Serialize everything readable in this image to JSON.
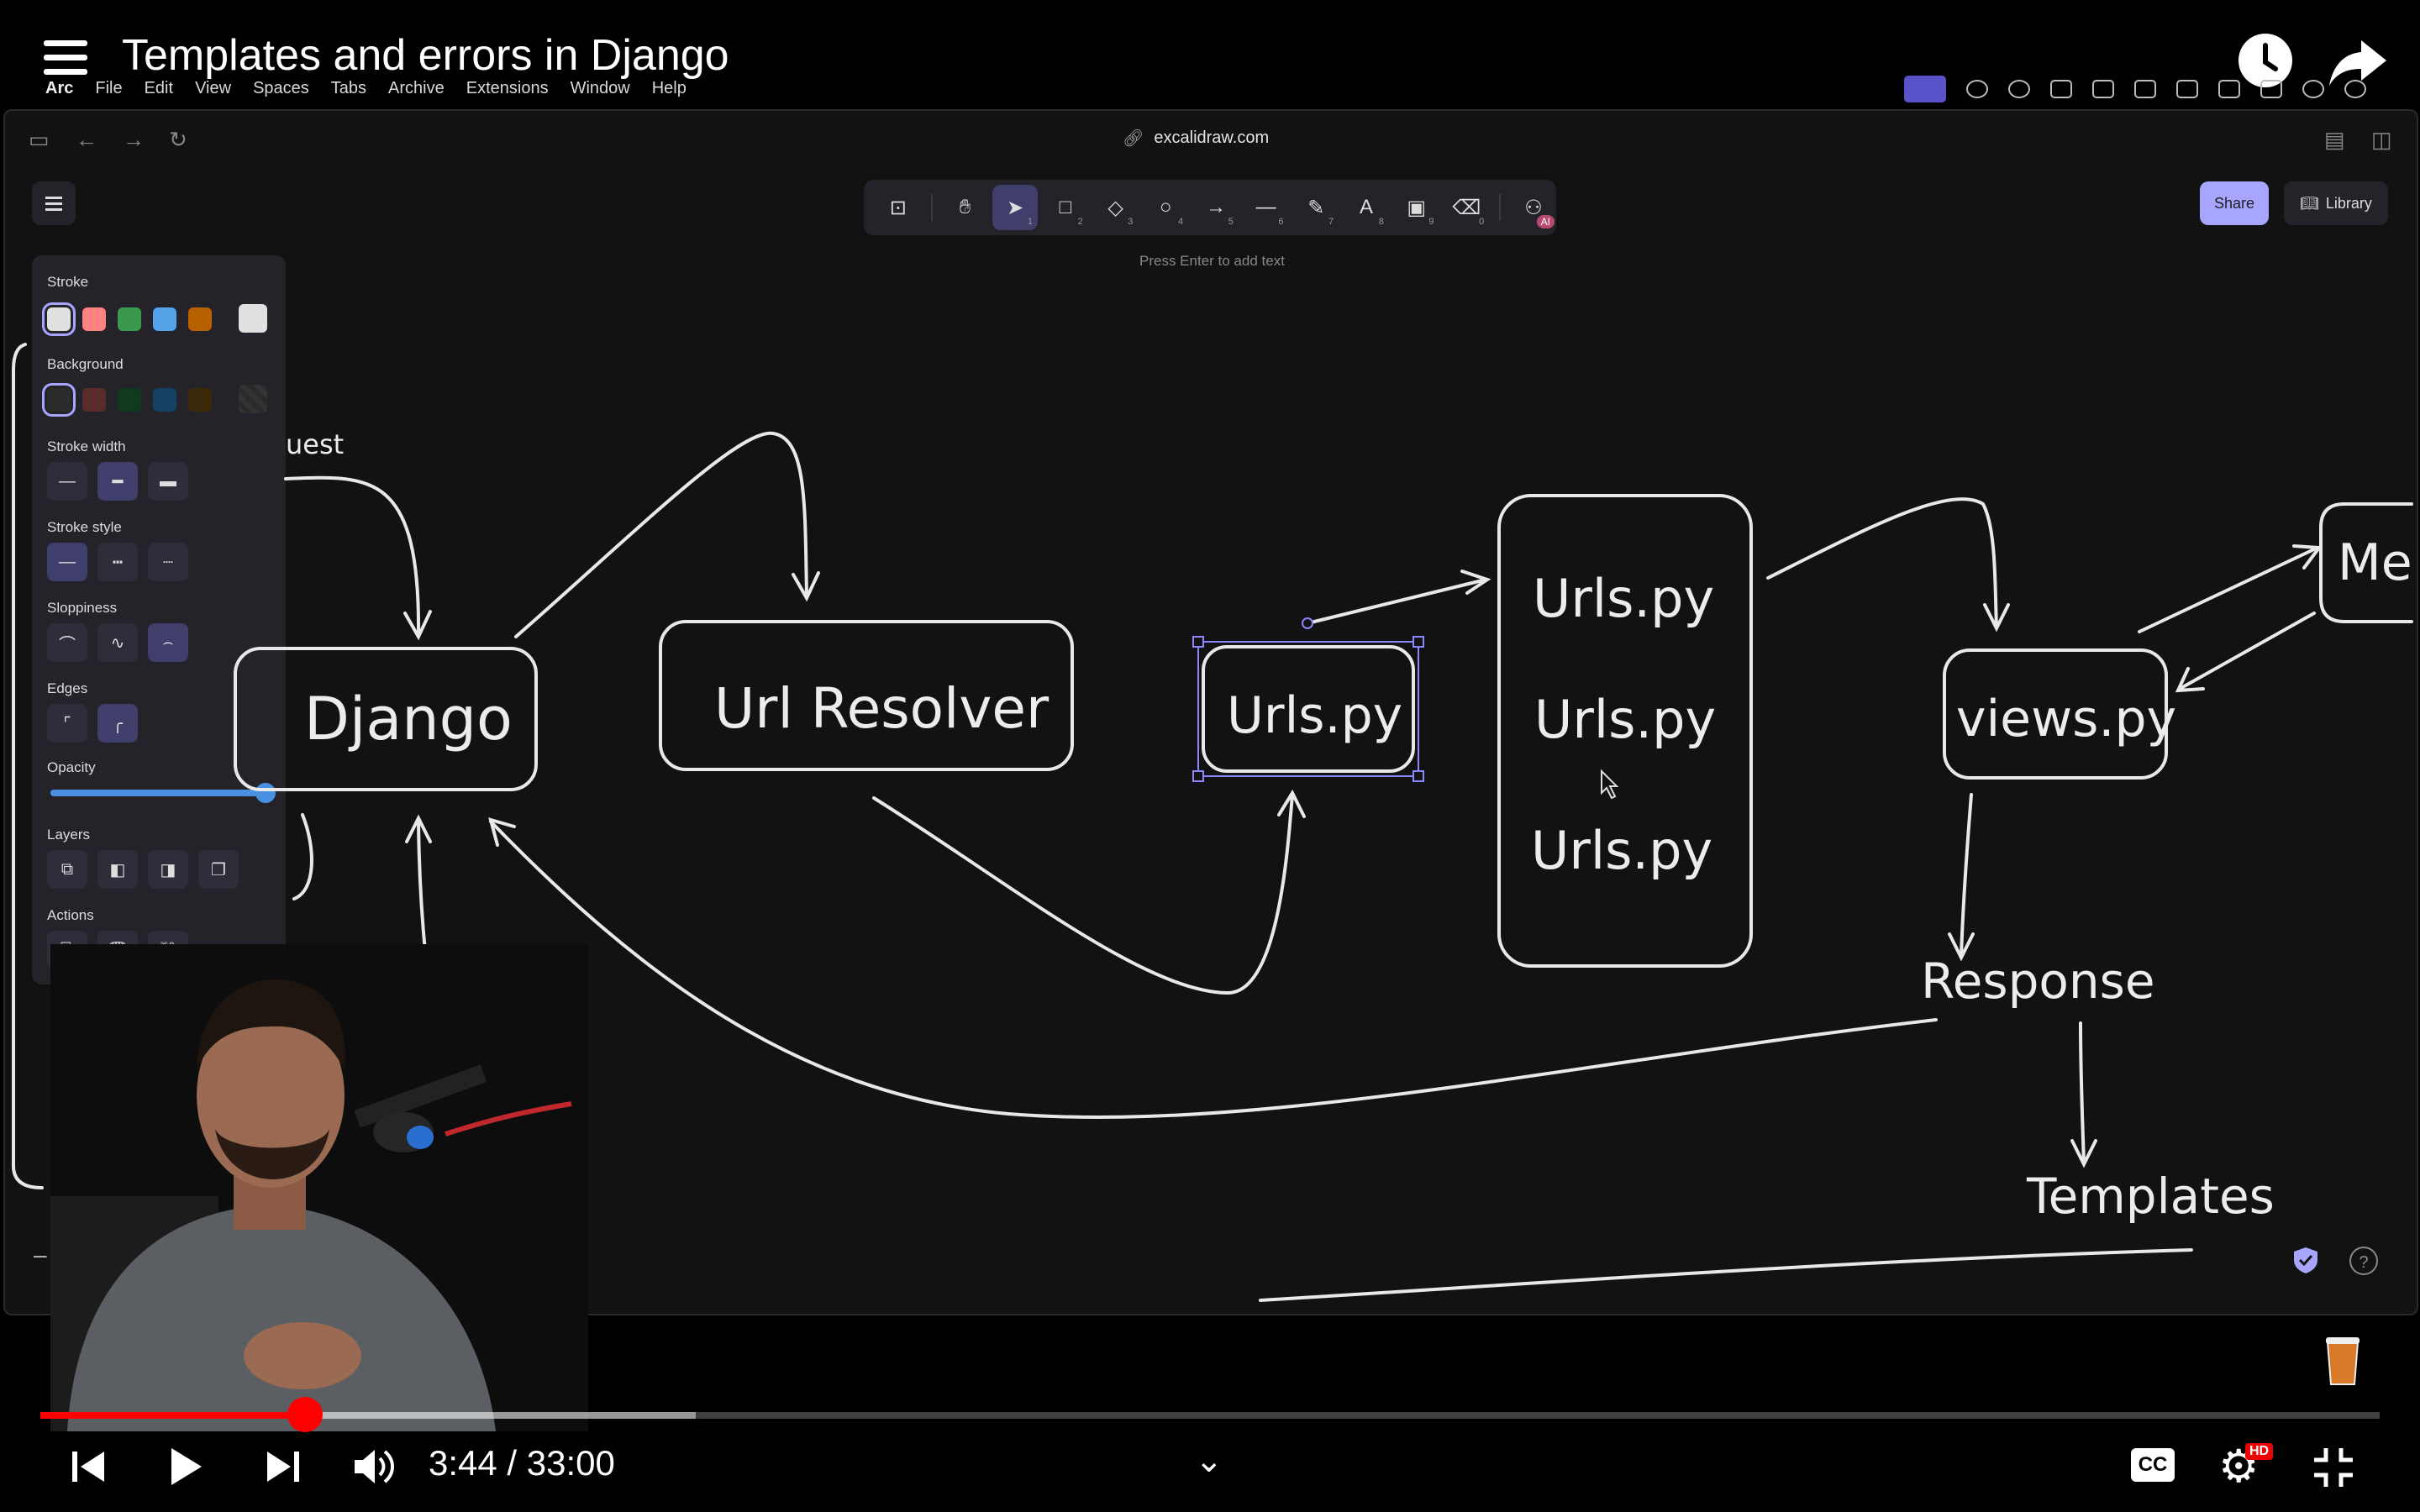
{
  "video": {
    "title": "Templates and errors in Django",
    "current_time": "3:44",
    "separator": "/",
    "duration": "33:00",
    "progress_fraction": 0.113,
    "buffered_fraction": 0.28,
    "cc_label": "CC",
    "hd_label": "HD"
  },
  "menubar": {
    "app": "Arc",
    "items": [
      "File",
      "Edit",
      "View",
      "Spaces",
      "Tabs",
      "Archive",
      "Extensions",
      "Window",
      "Help"
    ]
  },
  "browser": {
    "url": "excalidraw.com"
  },
  "excalidraw": {
    "hint": "Press Enter to add text",
    "share_label": "Share",
    "library_label": "Library",
    "ai_badge": "AI",
    "tools": [
      {
        "icon": "lock-icon",
        "key": ""
      },
      {
        "icon": "hand-icon",
        "key": ""
      },
      {
        "icon": "pointer-icon",
        "key": "1"
      },
      {
        "icon": "rectangle-icon",
        "key": "2"
      },
      {
        "icon": "diamond-icon",
        "key": "3"
      },
      {
        "icon": "ellipse-icon",
        "key": "4"
      },
      {
        "icon": "arrow-icon",
        "key": "5"
      },
      {
        "icon": "line-icon",
        "key": "6"
      },
      {
        "icon": "pencil-icon",
        "key": "7"
      },
      {
        "icon": "text-icon",
        "key": "8"
      },
      {
        "icon": "image-icon",
        "key": "9"
      },
      {
        "icon": "eraser-icon",
        "key": "0"
      },
      {
        "icon": "ai-shapes-icon",
        "key": ""
      }
    ],
    "panel": {
      "stroke": "Stroke",
      "background": "Background",
      "stroke_width": "Stroke width",
      "stroke_style": "Stroke style",
      "sloppiness": "Sloppiness",
      "edges": "Edges",
      "opacity": "Opacity",
      "layers": "Layers",
      "actions": "Actions",
      "stroke_colors": [
        "#e0e0e0",
        "#ff8383",
        "#3a994c",
        "#56a2e8",
        "#b76100"
      ],
      "stroke_current": "#e0e0e0",
      "background_colors": [
        "#2b2b2b",
        "#5c2b2b",
        "#0f3a1e",
        "#154163",
        "#3b2a0a"
      ],
      "opacity_value": 1.0
    }
  },
  "diagram": {
    "labels": {
      "request": "uest",
      "django": "Django",
      "url_resolver": "Url Resolver",
      "urls_selected": "Urls.py",
      "urls_1": "Urls.py",
      "urls_2": "Urls.py",
      "urls_3": "Urls.py",
      "views": "views.py",
      "models": "Me",
      "response": "Response",
      "templates": "Templates"
    },
    "stroke_color": "#e8e8e8",
    "selection_color": "#8b86ff"
  },
  "colors": {
    "youtube_red": "#ff0000",
    "excalidraw_accent": "#a8a5ff",
    "panel_bg": "#232329",
    "canvas_bg": "#121212"
  }
}
